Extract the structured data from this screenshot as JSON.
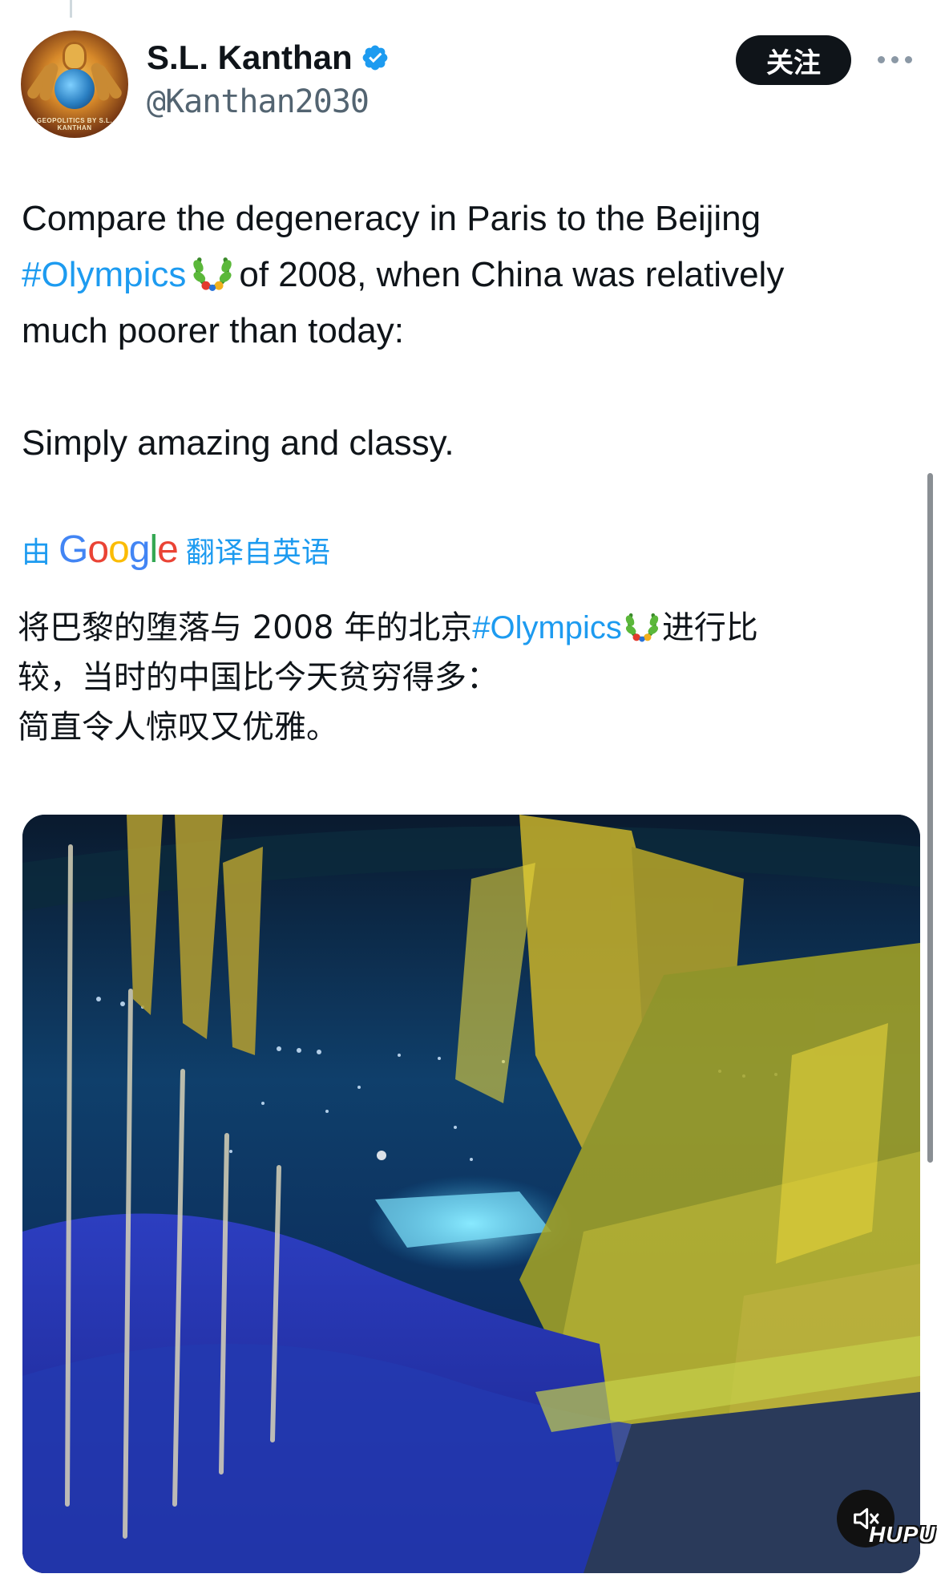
{
  "author": {
    "display_name": "S.L. Kanthan",
    "handle": "@Kanthan2030",
    "avatar_caption": "GEOPOLITICS BY S.L. KANTHAN",
    "verified_icon": "verified-badge-icon"
  },
  "actions": {
    "follow_label": "关注",
    "more_icon": "more-horizontal-icon"
  },
  "tweet": {
    "line1": "Compare the degeneracy in Paris to the Beijing",
    "hashtag": "#Olympics",
    "line2_rest": "of 2008, when China was relatively",
    "line3": "much poorer than today:",
    "line4": "Simply amazing and classy."
  },
  "translation": {
    "prefix": "由",
    "brand": "Google",
    "suffix": "翻译自英语",
    "line1_before": "将巴黎的堕落与 2008 年的北京",
    "hashtag": "#Olympics",
    "line1_after": "进行比",
    "line2": "较，当时的中国比今天贫穷得多：",
    "line3": "简直令人惊叹又优雅。"
  },
  "media": {
    "type": "video",
    "mute_icon": "speaker-muted-icon",
    "watermark": "HUPU"
  },
  "colors": {
    "link": "#1d9bf0",
    "text": "#0f1419",
    "secondary": "#536471",
    "button_bg": "#0f1419"
  }
}
